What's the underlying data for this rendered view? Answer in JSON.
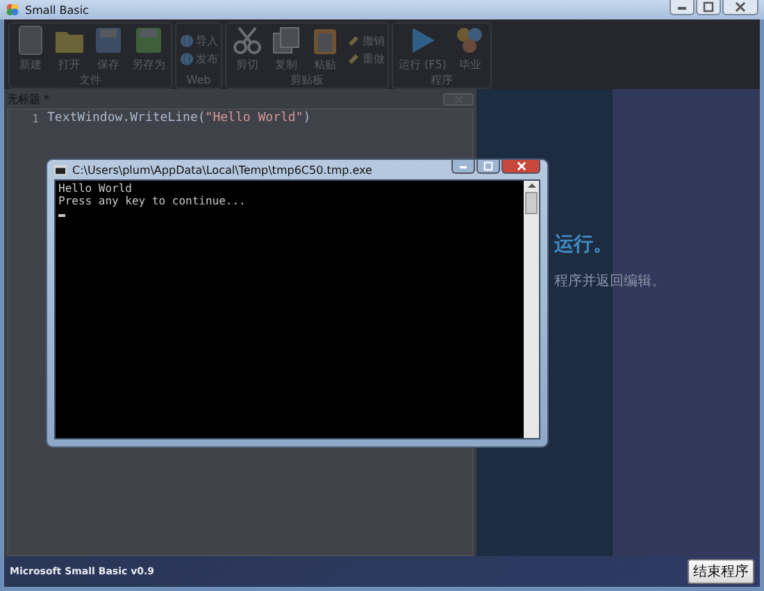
{
  "window": {
    "title": "Small Basic"
  },
  "ribbon": {
    "groups": [
      {
        "label": "文件",
        "items": [
          {
            "label": "新建",
            "kind": "large"
          },
          {
            "label": "打开",
            "kind": "large"
          },
          {
            "label": "保存",
            "kind": "large"
          },
          {
            "label": "另存为",
            "kind": "large"
          }
        ]
      },
      {
        "label": "Web",
        "items": [
          {
            "label": "导入",
            "kind": "small"
          },
          {
            "label": "发布",
            "kind": "small"
          }
        ]
      },
      {
        "label": "剪贴板",
        "items": [
          {
            "label": "剪切",
            "kind": "large"
          },
          {
            "label": "复制",
            "kind": "large"
          },
          {
            "label": "粘贴",
            "kind": "large"
          },
          {
            "label": "撤销",
            "kind": "small"
          },
          {
            "label": "重做",
            "kind": "small"
          }
        ]
      },
      {
        "label": "程序",
        "items": [
          {
            "label": "运行 (F5)",
            "kind": "large"
          },
          {
            "label": "毕业",
            "kind": "large"
          }
        ]
      }
    ]
  },
  "editor": {
    "tab": "无标题 *",
    "lines": [
      {
        "number": "1",
        "parts": [
          {
            "text": "TextWindow.WriteLine(",
            "kind": "code"
          },
          {
            "text": "\"Hello World\"",
            "kind": "string"
          },
          {
            "text": ")",
            "kind": "code"
          }
        ]
      }
    ]
  },
  "help_panel": {
    "lines": [
      {
        "text": "运行。",
        "kind": "heading"
      },
      {
        "text": "程序并返回编辑。",
        "kind": "body"
      }
    ]
  },
  "console": {
    "title": "C:\\Users\\plum\\AppData\\Local\\Temp\\tmp6C50.tmp.exe",
    "lines": [
      "Hello World",
      "Press any key to continue..."
    ]
  },
  "status_bar": {
    "version": "Microsoft Small Basic v0.9",
    "button": "结束程序"
  }
}
